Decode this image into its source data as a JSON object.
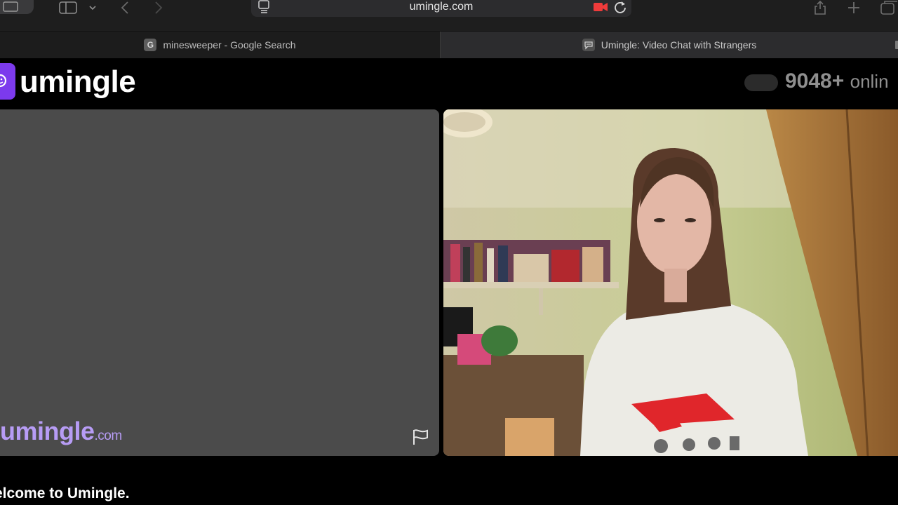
{
  "browser": {
    "url": "umingle.com",
    "tabs": [
      {
        "label": "minesweeper - Google Search",
        "favicon": "G"
      },
      {
        "label": "Umingle: Video Chat with Strangers",
        "favicon": "chat-bubble-icon"
      }
    ]
  },
  "header": {
    "brand": "umingle",
    "online_count": "9048+",
    "online_label": "onlin",
    "accent_color": "#7c3aed"
  },
  "left_pane": {
    "watermark_name": "umingle",
    "watermark_domain": ".com",
    "flag_icon": "flag-icon"
  },
  "right_pane": {
    "content": "remote-video-feed"
  },
  "footer": {
    "welcome": "elcome to Umingle."
  }
}
